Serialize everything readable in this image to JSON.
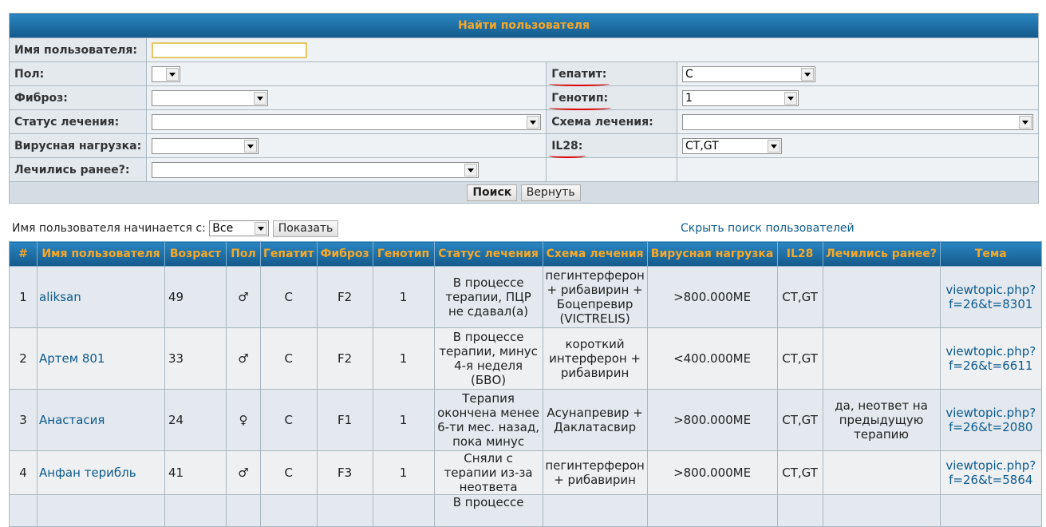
{
  "search": {
    "title": "Найти пользователя",
    "username_label": "Имя пользователя:",
    "username_value": "",
    "gender_label": "Пол:",
    "gender_value": "",
    "hepatitis_label": "Гепатит:",
    "hepatitis_value": "C",
    "fibrosis_label": "Фиброз:",
    "fibrosis_value": "",
    "genotype_label": "Генотип:",
    "genotype_value": "1",
    "treatment_status_label": "Статус лечения:",
    "treatment_status_value": "",
    "treatment_scheme_label": "Схема лечения:",
    "treatment_scheme_value": "",
    "viral_load_label": "Вирусная нагрузка:",
    "viral_load_value": "",
    "il28_label": "IL28:",
    "il28_value": "CT,GT",
    "treated_before_label": "Лечились ранее?:",
    "treated_before_value": "",
    "search_button": "Поиск",
    "reset_button": "Вернуть"
  },
  "filter": {
    "label": "Имя пользователя начинается с:",
    "value": "Все",
    "show_button": "Показать",
    "hide_link": "Скрыть поиск пользователей"
  },
  "results": {
    "columns": [
      "#",
      "Имя пользователя",
      "Возраст",
      "Пол",
      "Гепатит",
      "Фиброз",
      "Генотип",
      "Статус лечения",
      "Схема лечения",
      "Вирусная нагрузка",
      "IL28",
      "Лечились ранее?",
      "Тема"
    ],
    "rows": [
      {
        "n": "1",
        "user": "aliksan",
        "age": "49",
        "gender": "♂",
        "hep": "C",
        "fib": "F2",
        "geno": "1",
        "status": "В процессе терапии, ПЦР не сдавал(а)",
        "scheme": "пегинтерферон + рибавирин + Боцепревир (VICTRELIS)",
        "load": ">800.000МЕ",
        "il28": "CT,GT",
        "before": "",
        "topic": "viewtopic.php?f=26&t=8301"
      },
      {
        "n": "2",
        "user": "Артем 801",
        "age": "33",
        "gender": "♂",
        "hep": "C",
        "fib": "F2",
        "geno": "1",
        "status": "В процессе терапии, минус 4-я неделя (БВО)",
        "scheme": "короткий интерферон + рибавирин",
        "load": "<400.000МЕ",
        "il28": "CT,GT",
        "before": "",
        "topic": "viewtopic.php?f=26&t=6611"
      },
      {
        "n": "3",
        "user": "Анастасия",
        "age": "24",
        "gender": "♀",
        "hep": "C",
        "fib": "F1",
        "geno": "1",
        "status": "Терапия окончена менее 6-ти мес. назад, пока минус",
        "scheme": "Асунапревир + Даклатасвир",
        "load": ">800.000МЕ",
        "il28": "CT,GT",
        "before": "да, неответ на предыдущую терапию",
        "topic": "viewtopic.php?f=26&t=2080"
      },
      {
        "n": "4",
        "user": "Анфан терибль",
        "age": "41",
        "gender": "♂",
        "hep": "C",
        "fib": "F3",
        "geno": "1",
        "status": "Сняли с терапии из-за неответа",
        "scheme": "пегинтерферон + рибавирин",
        "load": ">800.000МЕ",
        "il28": "CT,GT",
        "before": "",
        "topic": "viewtopic.php?f=26&t=5864"
      },
      {
        "n": "",
        "user": "",
        "age": "",
        "gender": "",
        "hep": "",
        "fib": "",
        "geno": "",
        "status": "В процессе",
        "scheme": "",
        "load": "",
        "il28": "",
        "before": "",
        "topic": ""
      }
    ]
  }
}
